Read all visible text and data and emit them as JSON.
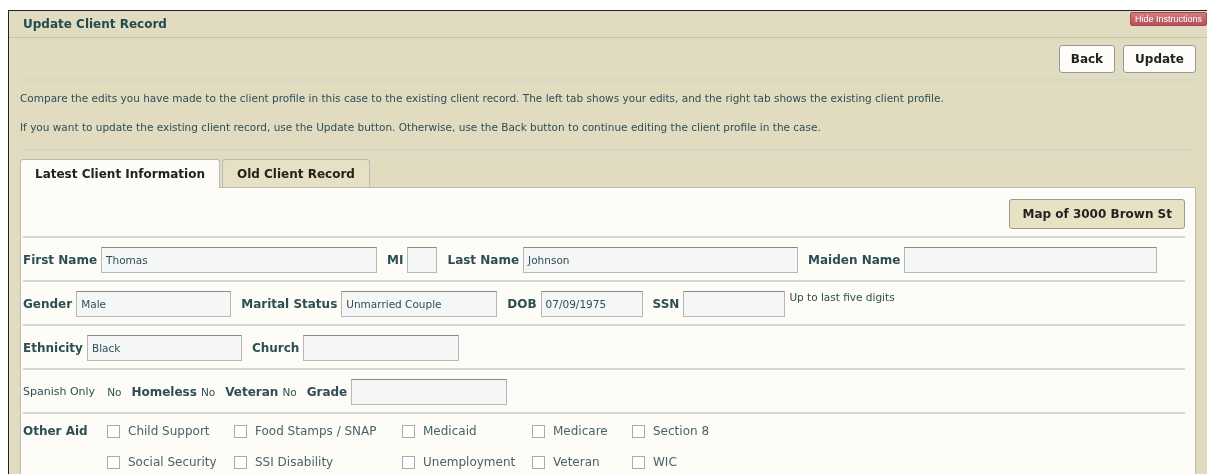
{
  "window": {
    "title": "Update Client Record"
  },
  "hide_instructions": "Hide Instructions",
  "buttons": [
    "Back",
    "Update"
  ],
  "instructions": [
    "Compare the edits you have made to the client profile in this case to the existing client record. The left tab shows your edits, and the right tab shows the existing client profile.",
    "If you want to update the existing client record, use the Update button. Otherwise, use the Back button to continue editing the client profile in the case."
  ],
  "tabs": [
    {
      "label": "Latest Client Information",
      "selected": true
    },
    {
      "label": "Old Client Record",
      "selected": false
    }
  ],
  "map_button": "Map of 3000 Brown St",
  "rows": [
    [
      {
        "kind": "field",
        "label": "First Name",
        "value": "Thomas"
      },
      {
        "kind": "field",
        "label": "MI"
      },
      {
        "kind": "field",
        "label": "Last Name",
        "value": "Johnson"
      },
      {
        "kind": "field",
        "label": "Maiden Name"
      }
    ],
    [
      {
        "kind": "field",
        "label": "Gender",
        "value": "Male"
      },
      {
        "kind": "field",
        "label": "Marital Status",
        "value": "Unmarried Couple"
      },
      {
        "kind": "field",
        "label": "DOB",
        "value": "07/09/1975"
      },
      {
        "kind": "field",
        "label": "SSN",
        "note": "Up to last five digits"
      }
    ],
    [
      {
        "kind": "field",
        "label": "Ethnicity",
        "value": "Black"
      },
      {
        "kind": "field",
        "label": "Church"
      }
    ],
    [
      {
        "kind": "flag",
        "label": "Spanish Only",
        "value": "No"
      },
      {
        "kind": "flag",
        "label": "Homeless",
        "value": "No"
      },
      {
        "kind": "flag",
        "label": "Veteran",
        "value": "No"
      },
      {
        "kind": "field",
        "label": "Grade"
      }
    ]
  ],
  "other_aid": {
    "label": "Other Aid",
    "items": [
      {
        "label": "Child Support",
        "checked": false
      },
      {
        "label": "Food Stamps / SNAP",
        "checked": false
      },
      {
        "label": "Medicaid",
        "checked": false
      },
      {
        "label": "Medicare",
        "checked": false
      },
      {
        "label": "Section 8",
        "checked": false
      },
      {
        "label": "Social Security",
        "checked": false
      },
      {
        "label": "SSI Disability",
        "checked": false
      },
      {
        "label": "Unemployment",
        "checked": false
      },
      {
        "label": "Veteran",
        "checked": false
      },
      {
        "label": "WIC",
        "checked": false
      }
    ]
  }
}
